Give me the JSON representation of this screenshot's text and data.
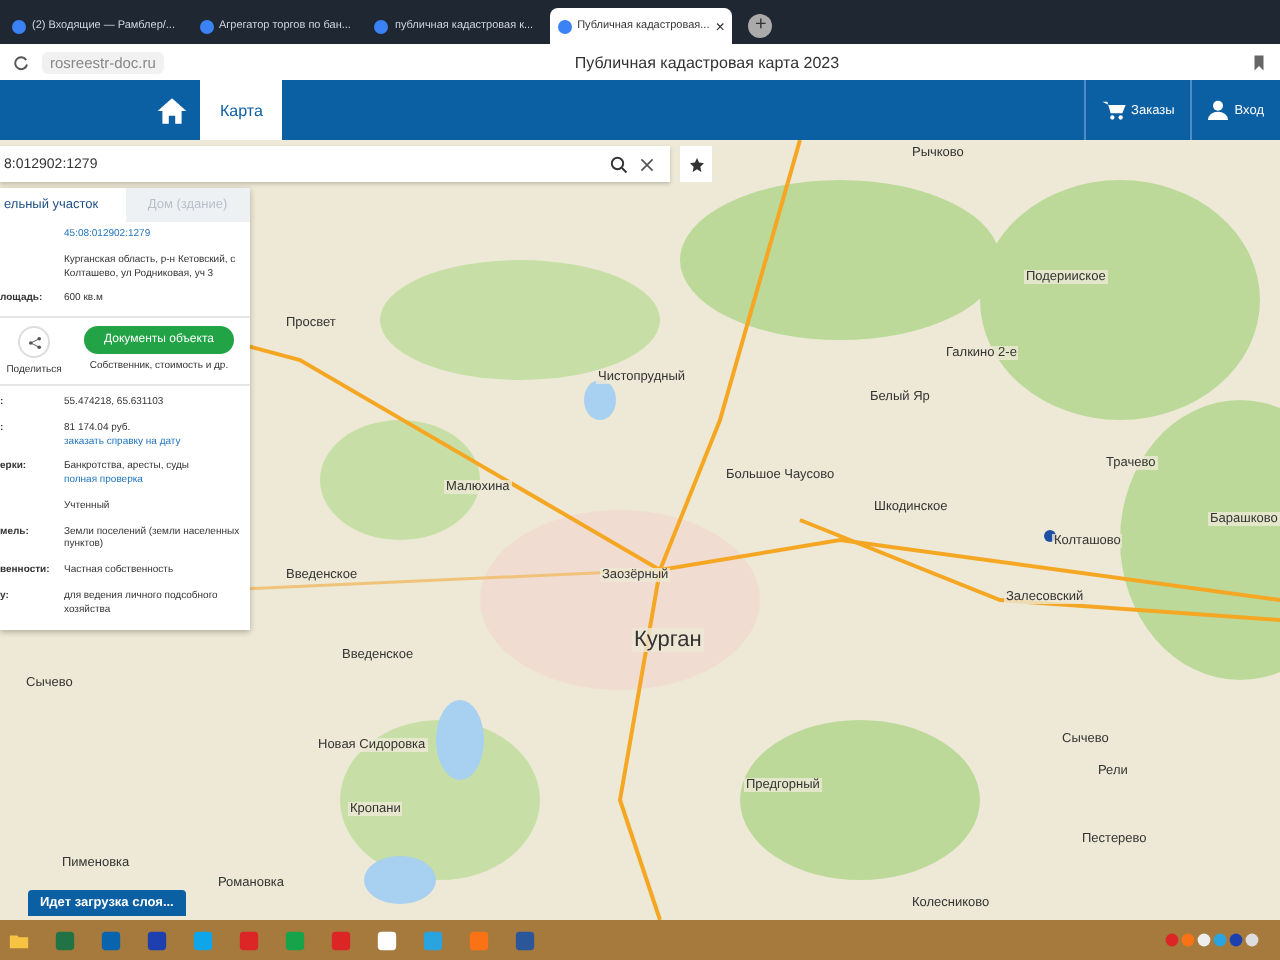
{
  "browser": {
    "tabs": [
      {
        "title": "(2) Входящие — Рамблер/...",
        "selected": false
      },
      {
        "title": "Агрегатор торгов по бан...",
        "selected": false
      },
      {
        "title": "публичная кадастровая к...",
        "selected": false
      },
      {
        "title": "Публичная кадастровая...",
        "selected": true,
        "close": "×"
      }
    ],
    "new_tab": "+",
    "url": "rosreestr-doc.ru",
    "page_title": "Публичная кадастровая карта 2023"
  },
  "nav": {
    "items": [
      {
        "label": "Карта",
        "selected": true
      }
    ],
    "orders": "Заказы",
    "login": "Вход"
  },
  "search": {
    "value": "8:012902:1279"
  },
  "panel": {
    "tabs": [
      {
        "label": "ельный участок",
        "selected": true,
        "disabled": false
      },
      {
        "label": "Дом (здание)",
        "selected": false,
        "disabled": true
      }
    ],
    "top_rows": [
      {
        "label": "",
        "value": "45:08:012902:1279",
        "kind": "link"
      },
      {
        "label": "",
        "value": "Курганская область, р-н Кетовский, с Колташево, ул Родниковая, уч 3",
        "kind": "text"
      },
      {
        "label": "лощадь:",
        "value": "600 кв.м",
        "kind": "text"
      }
    ],
    "share": "Поделиться",
    "documents_button": "Документы объекта",
    "documents_caption": "Собственник, стоимость и др.",
    "rows": [
      {
        "label": ":",
        "value": "55.474218, 65.631103"
      },
      {
        "label": ":",
        "value": "81 174.04 руб.",
        "link": "заказать справку на дату"
      },
      {
        "label": "ерки:",
        "value": "Банкротства, аресты, суды",
        "link": "полная проверка"
      },
      {
        "label": "",
        "value": "Учтенный"
      },
      {
        "label": "мель:",
        "value": "Земли поселений (земли населенных пунктов)"
      },
      {
        "label": "венности:",
        "value": "Частная собственность"
      },
      {
        "label": "у:",
        "value": "для ведения личного подсобного хозяйства"
      }
    ]
  },
  "map": {
    "places": [
      "Рычково",
      "Подерииское",
      "Галкино 2-е",
      "Чистопрудный",
      "Белый Яр",
      "Просвет",
      "Малюхина",
      "Большое Чаусово",
      "Шкодинское",
      "Трачево",
      "Колташово",
      "Барашково",
      "Заозёрный",
      "Залесовский",
      "Курган",
      "Введенское",
      "Введенское",
      "Сычево",
      "Новая Сидоровка",
      "Кропани",
      "Сычево",
      "Предгорный",
      "Рели",
      "Пестерево",
      "Романовка",
      "Пименовка",
      "Колесниково"
    ]
  },
  "toast": "Идет загрузка слоя..."
}
